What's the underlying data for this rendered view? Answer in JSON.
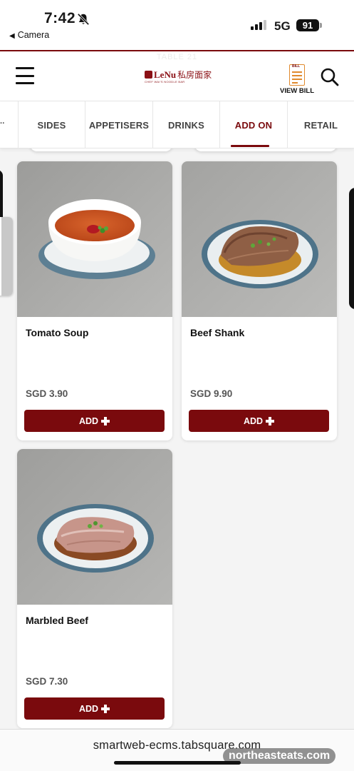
{
  "status_bar": {
    "time": "7:42",
    "back_app": "Camera",
    "network": "5G",
    "battery": "91"
  },
  "header": {
    "table_label": "TABLE 21",
    "logo_text": "LeNu",
    "logo_cn": "私房面家",
    "logo_sub": "CHEF WAI'S NOODLE BAR",
    "view_bill_label": "VIEW BILL",
    "bill_icon_tag": "BILL"
  },
  "tabs": [
    {
      "label": "SIDES"
    },
    {
      "label": "APPETISERS"
    },
    {
      "label": "DRINKS"
    },
    {
      "label": "ADD ON",
      "active": true
    },
    {
      "label": "RETAIL"
    }
  ],
  "tab_overflow": "..",
  "items": [
    {
      "name": "Tomato Soup",
      "price": "SGD 3.90",
      "add_label": "ADD",
      "image": "tomato-soup"
    },
    {
      "name": "Beef Shank",
      "price": "SGD 9.90",
      "add_label": "ADD",
      "image": "beef-shank"
    },
    {
      "name": "Marbled Beef",
      "price": "SGD 7.30",
      "add_label": "ADD",
      "image": "marbled-beef"
    }
  ],
  "browser": {
    "url": "smartweb-ecms.tabsquare.com"
  },
  "watermark": "northeasteats.com",
  "colors": {
    "brand": "#7a0a0d",
    "bill_icon": "#e08a2e",
    "background": "#f4f4f4"
  },
  "icons": [
    "bell-slash-icon",
    "signal-icon",
    "battery-icon",
    "menu-icon",
    "bill-icon",
    "search-icon",
    "plus-icon"
  ]
}
